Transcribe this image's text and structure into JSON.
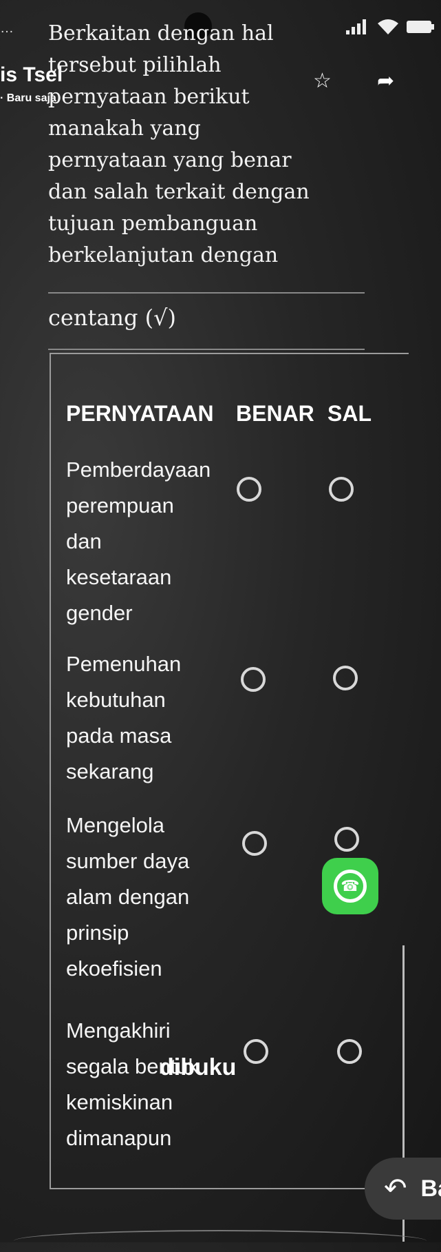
{
  "status_bar": {
    "left_text": "…",
    "carrier": "is Tsel",
    "subtitle": "· Baru saja"
  },
  "question": {
    "lines": [
      "Berkaitan dengan hal",
      "tersebut pilihlah",
      "pernyataan berikut",
      "manakah yang",
      "pernyataan yang benar",
      "dan salah terkait dengan",
      "tujuan pembanguan",
      "berkelanjutan dengan"
    ],
    "instruction": "centang (√)"
  },
  "table": {
    "headers": [
      "PERNYATAAN",
      "BENAR",
      "SAL"
    ],
    "rows": [
      {
        "lines": [
          "Pemberdayaan",
          "perempuan",
          "dan",
          "kesetaraan",
          "gender"
        ]
      },
      {
        "lines": [
          "Pemenuhan",
          "kebutuhan",
          "pada masa",
          "sekarang"
        ]
      },
      {
        "lines": [
          "Mengelola",
          "sumber daya",
          "alam dengan",
          "prinsip",
          "ekoefisien"
        ]
      },
      {
        "lines": [
          "Mengakhiri",
          "segala bentuk",
          "kemiskinan",
          "dimanapun"
        ]
      }
    ]
  },
  "overlay_text": "dibuku",
  "back_button": {
    "label": "Ba"
  },
  "icons": {
    "star": "star-icon",
    "forward": "forward-arrow-icon",
    "back": "back-arrow-icon",
    "whatsapp": "whatsapp-icon"
  },
  "colors": {
    "whatsapp_green": "#3fcf4c"
  }
}
